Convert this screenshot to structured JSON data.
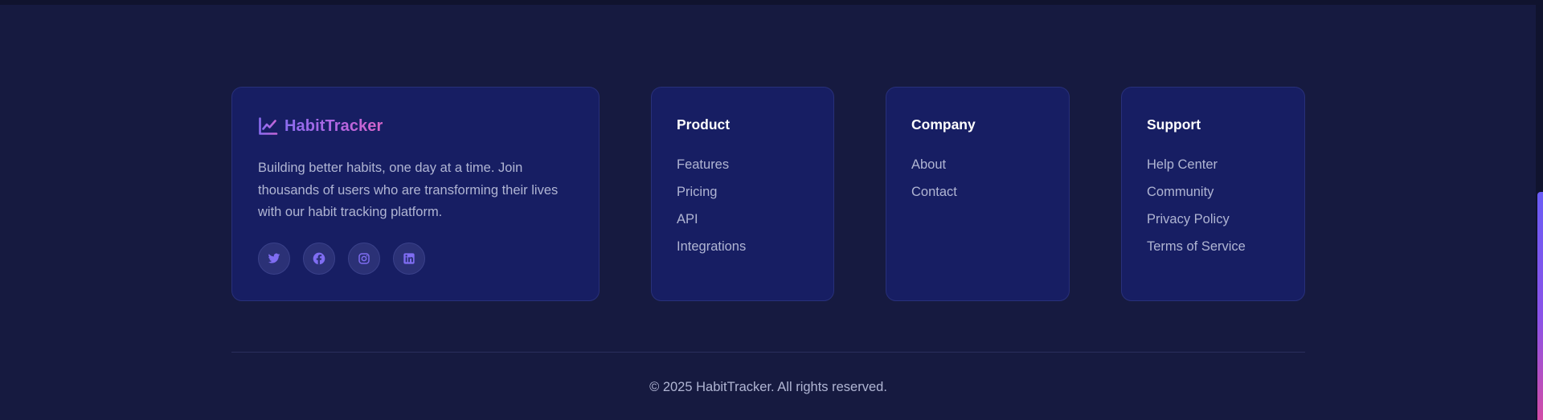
{
  "brand": {
    "name": "HabitTracker",
    "icon": "chart-line-icon",
    "description": "Building better habits, one day at a time. Join thousands of users who are transforming their lives with our habit tracking platform."
  },
  "social_links": [
    {
      "name": "twitter",
      "icon": "twitter-icon"
    },
    {
      "name": "facebook",
      "icon": "facebook-icon"
    },
    {
      "name": "instagram",
      "icon": "instagram-icon"
    },
    {
      "name": "linkedin",
      "icon": "linkedin-icon"
    }
  ],
  "columns": {
    "product": {
      "title": "Product",
      "links": [
        "Features",
        "Pricing",
        "API",
        "Integrations"
      ]
    },
    "company": {
      "title": "Company",
      "links": [
        "About",
        "Contact"
      ]
    },
    "support": {
      "title": "Support",
      "links": [
        "Help Center",
        "Community",
        "Privacy Policy",
        "Terms of Service"
      ]
    }
  },
  "copyright": "© 2025 HabitTracker. All rights reserved.",
  "colors": {
    "background": "#161a40",
    "card": "#171e63",
    "card_border": "#28307a",
    "accent_start": "#8b6cf0",
    "accent_end": "#d565c8",
    "icon_accent": "#7f6df2",
    "text_muted": "#b0b5d3",
    "heading": "#ffffff"
  }
}
